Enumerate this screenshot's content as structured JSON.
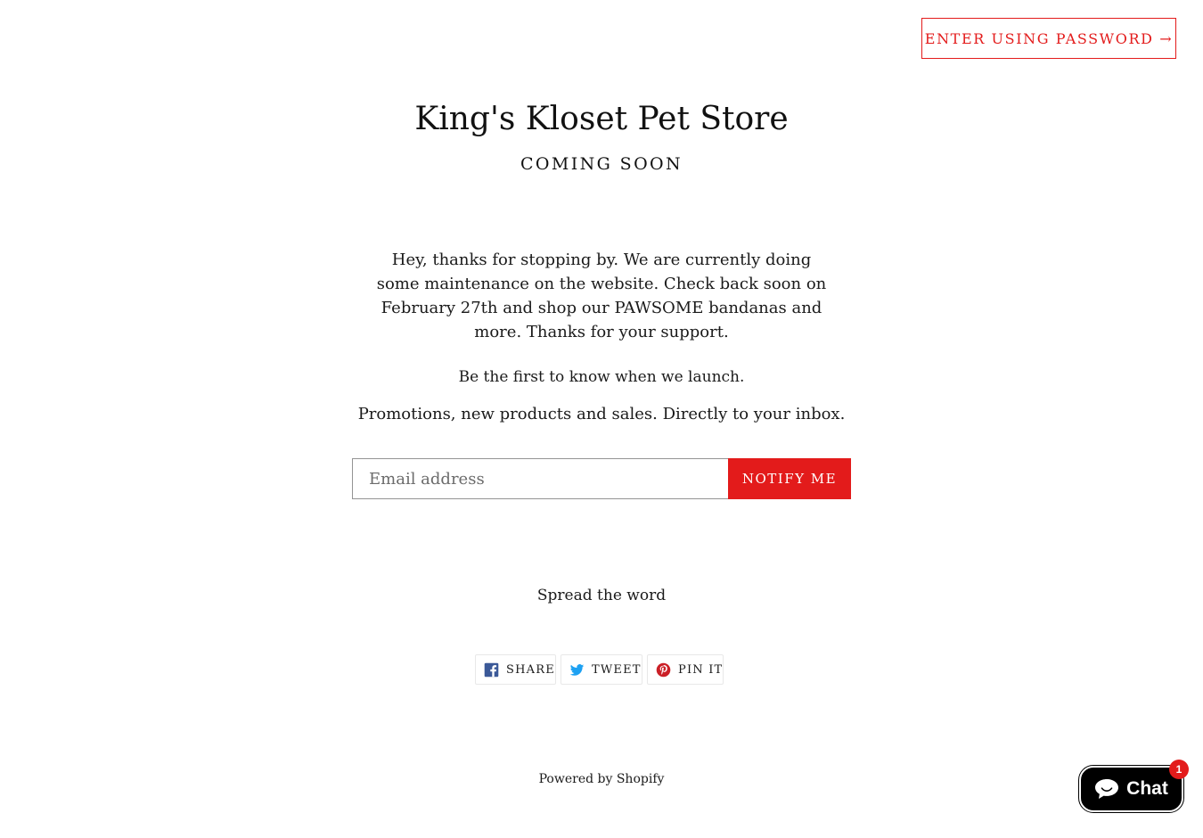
{
  "header": {
    "password_button_label": "ENTER USING PASSWORD →"
  },
  "store": {
    "title": "King's Kloset Pet Store",
    "subtitle": "COMING SOON",
    "message": "Hey, thanks for stopping by. We are currently doing some maintenance on the website. Check back soon on February 27th and shop our PAWSOME bandanas and more. Thanks for your support."
  },
  "newsletter": {
    "heading": "Be the first to know when we launch.",
    "subheading": "Promotions, new products and sales. Directly to your inbox.",
    "email_placeholder": "Email address",
    "email_value": "",
    "submit_label": "NOTIFY ME"
  },
  "social": {
    "heading": "Spread the word",
    "buttons": [
      {
        "label": "SHARE",
        "icon": "facebook-icon"
      },
      {
        "label": "TWEET",
        "icon": "twitter-icon"
      },
      {
        "label": "PIN IT",
        "icon": "pinterest-icon"
      }
    ]
  },
  "footer": {
    "powered_by": "Powered by Shopify"
  },
  "chat": {
    "label": "Chat",
    "icon": "chat-bubble-icon",
    "badge_count": "1"
  },
  "colors": {
    "accent": "#e31b1b",
    "text": "#1a1a1a",
    "background": "#ffffff",
    "chat_background": "#000000"
  }
}
